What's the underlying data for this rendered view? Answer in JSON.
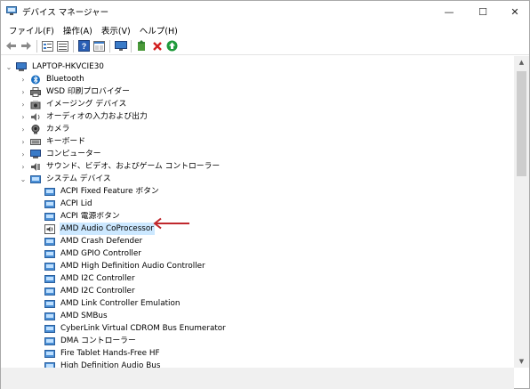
{
  "window": {
    "title": "デバイス マネージャー",
    "buttons": {
      "minimize": "—",
      "maximize": "☐",
      "close": "✕"
    }
  },
  "menu": [
    "ファイル(F)",
    "操作(A)",
    "表示(V)",
    "ヘルプ(H)"
  ],
  "toolbar": [
    "back-arrow-icon",
    "forward-arrow-icon",
    "properties-icon",
    "list-icon",
    "help-icon",
    "panel-icon",
    "monitor-icon",
    "update-driver-icon",
    "uninstall-x-icon",
    "enable-device-icon"
  ],
  "colors": {
    "selection": "#cce8ff",
    "annotation_arrow": "#c0282d",
    "device_icon": "#4a8fd6"
  },
  "tree": {
    "root": "LAPTOP-HKVCIE30",
    "categories": [
      {
        "label": "Bluetooth",
        "icon": "bluetooth-icon",
        "expanded": false
      },
      {
        "label": "WSD 印刷プロバイダー",
        "icon": "printer-icon",
        "expanded": false
      },
      {
        "label": "イメージング デバイス",
        "icon": "imaging-device-icon",
        "expanded": false
      },
      {
        "label": "オーディオの入力および出力",
        "icon": "speaker-icon",
        "expanded": false
      },
      {
        "label": "カメラ",
        "icon": "camera-icon",
        "expanded": false
      },
      {
        "label": "キーボード",
        "icon": "keyboard-icon",
        "expanded": false
      },
      {
        "label": "コンピューター",
        "icon": "computer-icon",
        "expanded": false
      },
      {
        "label": "サウンド、ビデオ、およびゲーム コントローラー",
        "icon": "sound-icon",
        "expanded": false
      },
      {
        "label": "システム デバイス",
        "icon": "system-device-icon",
        "expanded": true
      }
    ],
    "system_devices": [
      "ACPI Fixed Feature ボタン",
      "ACPI Lid",
      "ACPI 電源ボタン",
      "AMD Audio CoProcessor",
      "AMD Crash Defender",
      "AMD GPIO Controller",
      "AMD High Definition Audio Controller",
      "AMD I2C Controller",
      "AMD I2C Controller",
      "AMD Link Controller Emulation",
      "AMD SMBus",
      "CyberLink Virtual CDROM Bus Enumerator",
      "DMA コントローラー",
      "Fire Tablet Hands-Free HF",
      "High Definition Audio Bus"
    ],
    "selected": "AMD Audio CoProcessor"
  }
}
